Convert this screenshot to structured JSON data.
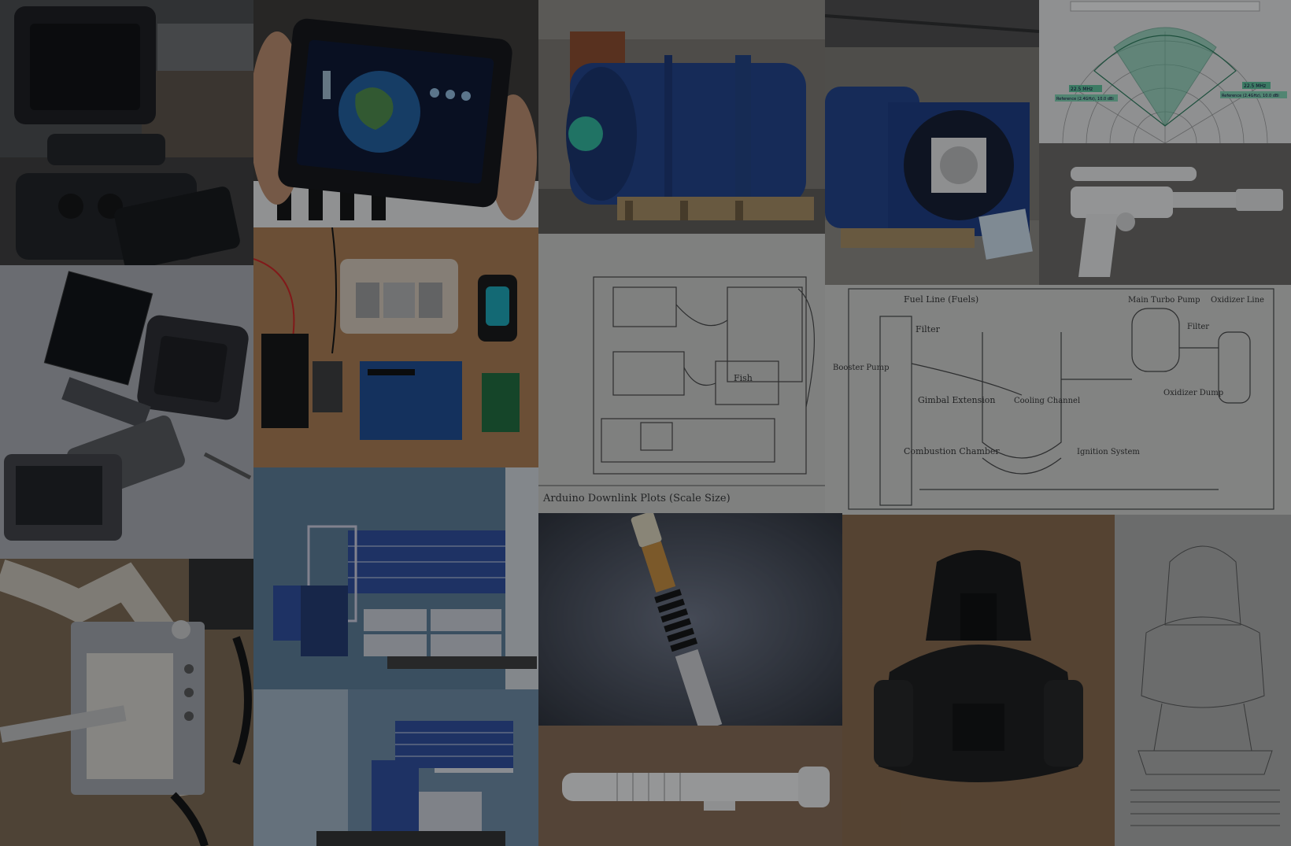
{
  "gallery": {
    "overlay_opacity": 0.38,
    "tiles": [
      {
        "id": "handheld-console-build",
        "kind": "photo",
        "bg": "#3a3a3c"
      },
      {
        "id": "handheld-console-screen",
        "kind": "photo",
        "bg": "#2b2826"
      },
      {
        "id": "wind-tunnel-front",
        "kind": "photo",
        "bg": "#6f6a63"
      },
      {
        "id": "wind-tunnel-side",
        "kind": "photo",
        "bg": "#6c6862"
      },
      {
        "id": "polar-plot",
        "kind": "chart",
        "bg": "#dcdcdc",
        "accent": "#4fae8a"
      },
      {
        "id": "console-exploded-cad",
        "kind": "cad",
        "bg": "#9c9da4"
      },
      {
        "id": "arduino-parts-layout",
        "kind": "photo",
        "bg": "#a0744b"
      },
      {
        "id": "arduino-downlink-sketch",
        "kind": "sketch",
        "bg": "#bfbfbc"
      },
      {
        "id": "rocket-engine-sketch",
        "kind": "sketch",
        "bg": "#c4c4c2"
      },
      {
        "id": "printed-blaster",
        "kind": "photo",
        "bg": "#5d5a57"
      },
      {
        "id": "mechanism-prototype",
        "kind": "photo",
        "bg": "#6d5b46"
      },
      {
        "id": "desk-cad-front",
        "kind": "cad",
        "bg": "#4a6a86",
        "accent": "#2c4b9a"
      },
      {
        "id": "desk-cad-perspective",
        "kind": "cad",
        "bg": "#4e6d88",
        "accent": "#2c4b9a"
      },
      {
        "id": "lightsaber-render",
        "kind": "render",
        "bg": "#3b4049"
      },
      {
        "id": "lightsaber-print",
        "kind": "photo",
        "bg": "#7b6048"
      },
      {
        "id": "helmet-print",
        "kind": "photo",
        "bg": "#7c5e40"
      },
      {
        "id": "helmet-sketch",
        "kind": "sketch",
        "bg": "#9a9a98"
      }
    ],
    "sketch_text": {
      "arduino_caption": "Arduino Downlink Plots (Scale Size)",
      "arduino_label": "Fish",
      "rocket_fuel": "Fuel Line (Fuels)",
      "rocket_filter": "Filter",
      "rocket_turbo": "Main Turbo Pump",
      "rocket_oxidizer": "Oxidizer Line",
      "rocket_filter2": "Filter",
      "rocket_booster": "Booster Pump",
      "rocket_gimbal": "Gimbal Extension",
      "rocket_cooling": "Cooling Channel",
      "rocket_combustion": "Combustion Chamber",
      "rocket_ignition": "Ignition System",
      "rocket_oxidizer_dump": "Oxidizer Dump"
    },
    "polar_legend": {
      "left_top": "22.5 MHz",
      "left_bot": "Reference (2.4GHz), 10.0 dBi",
      "right_top": "22.5 MHz",
      "right_bot": "Reference (2.4GHz), 10.0 dBi"
    }
  }
}
